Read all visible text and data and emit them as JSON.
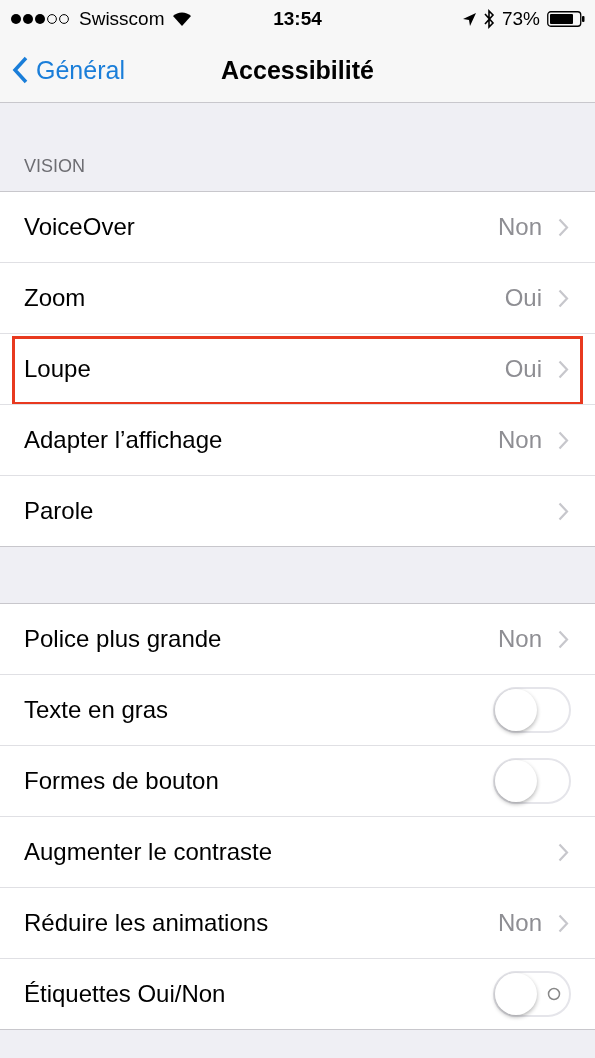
{
  "status_bar": {
    "carrier": "Swisscom",
    "time": "13:54",
    "battery": "73%"
  },
  "nav": {
    "back": "Général",
    "title": "Accessibilité"
  },
  "sections": [
    {
      "header": "VISION",
      "rows": [
        {
          "kind": "disclosure",
          "label": "VoiceOver",
          "value": "Non",
          "highlighted": false
        },
        {
          "kind": "disclosure",
          "label": "Zoom",
          "value": "Oui",
          "highlighted": false
        },
        {
          "kind": "disclosure",
          "label": "Loupe",
          "value": "Oui",
          "highlighted": true
        },
        {
          "kind": "disclosure",
          "label": "Adapter l’affichage",
          "value": "Non",
          "highlighted": false
        },
        {
          "kind": "disclosure",
          "label": "Parole",
          "highlighted": false
        }
      ]
    },
    {
      "rows": [
        {
          "kind": "disclosure",
          "label": "Police plus grande",
          "value": "Non",
          "highlighted": false
        },
        {
          "kind": "toggle",
          "label": "Texte en gras",
          "on": false,
          "on_off_labels": false,
          "highlighted": false
        },
        {
          "kind": "toggle",
          "label": "Formes de bouton",
          "on": false,
          "on_off_labels": false,
          "highlighted": false
        },
        {
          "kind": "disclosure",
          "label": "Augmenter le contraste",
          "highlighted": false
        },
        {
          "kind": "disclosure",
          "label": "Réduire les animations",
          "value": "Non",
          "highlighted": false
        },
        {
          "kind": "toggle",
          "label": "Étiquettes Oui/Non",
          "on": false,
          "on_off_labels": true,
          "highlighted": false
        }
      ]
    }
  ]
}
